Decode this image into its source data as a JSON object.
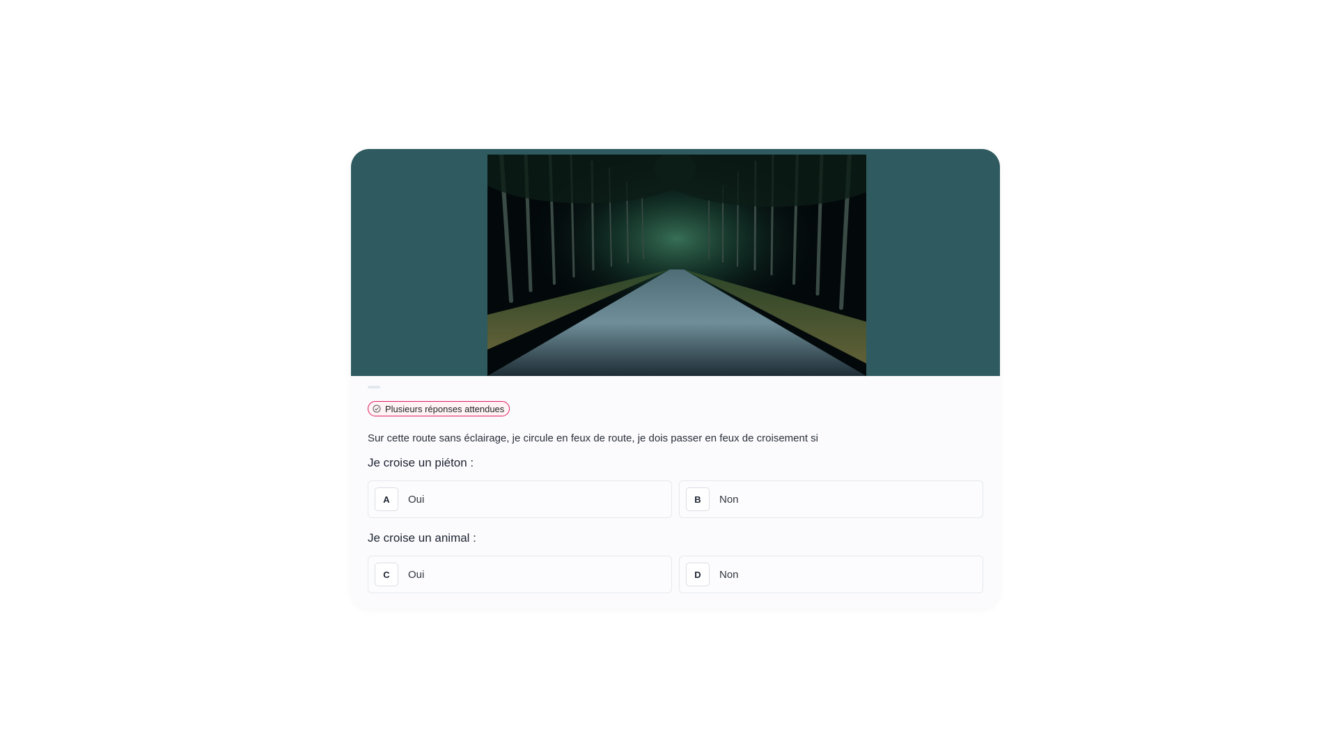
{
  "badge": {
    "label": "Plusieurs réponses attendues",
    "icon": "check-circle-icon",
    "color": "#e2195b"
  },
  "media": {
    "background": "#2f5a5f",
    "photo_subject": "road-at-night-icon"
  },
  "statement": "Sur cette route sans éclairage, je circule en feux de route, je dois passer en feux de croisement si",
  "questions": [
    {
      "label": "Je croise un piéton :",
      "answers": [
        {
          "letter": "A",
          "label": "Oui"
        },
        {
          "letter": "B",
          "label": "Non"
        }
      ]
    },
    {
      "label": "Je croise un animal :",
      "answers": [
        {
          "letter": "C",
          "label": "Oui"
        },
        {
          "letter": "D",
          "label": "Non"
        }
      ]
    }
  ]
}
